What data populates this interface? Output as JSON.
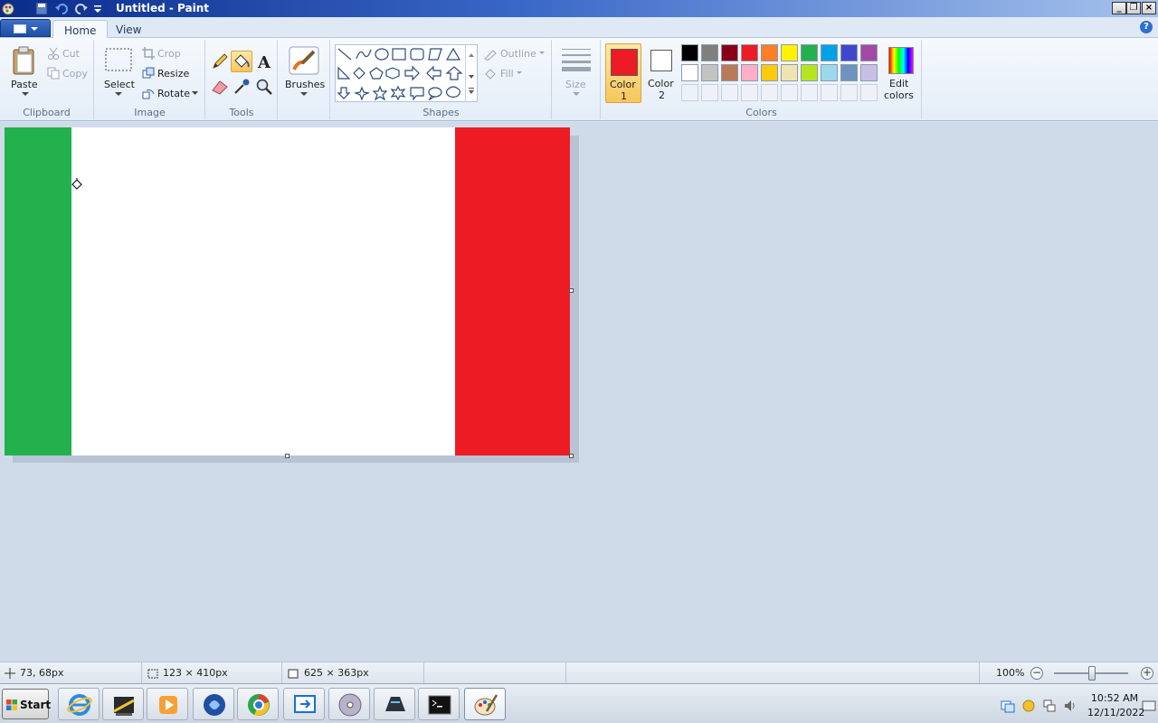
{
  "window": {
    "title": "Untitled - Paint"
  },
  "tabs": [
    {
      "label": "Home",
      "active": true
    },
    {
      "label": "View",
      "active": false
    }
  ],
  "ribbon": {
    "clipboard": {
      "group_label": "Clipboard",
      "paste": "Paste",
      "cut": "Cut",
      "copy": "Copy"
    },
    "image": {
      "group_label": "Image",
      "select": "Select",
      "crop": "Crop",
      "resize": "Resize",
      "rotate": "Rotate"
    },
    "tools": {
      "group_label": "Tools",
      "text_tool_glyph": "A"
    },
    "brushes": {
      "label": "Brushes"
    },
    "shapes": {
      "group_label": "Shapes",
      "outline": "Outline",
      "fill": "Fill"
    },
    "size": {
      "label": "Size"
    },
    "colors": {
      "group_label": "Colors",
      "color1_line1": "Color",
      "color1_line2": "1",
      "color2_line1": "Color",
      "color2_line2": "2",
      "edit_line1": "Edit",
      "edit_line2": "colors",
      "color1_value": "#ed1c24",
      "color2_value": "#ffffff",
      "palette_row1": [
        "#000000",
        "#7f7f7f",
        "#880015",
        "#ed1c24",
        "#ff7f27",
        "#fff200",
        "#22b14c",
        "#00a2e8",
        "#3f48cc",
        "#a349a4"
      ],
      "palette_row2": [
        "#ffffff",
        "#c3c3c3",
        "#b97a57",
        "#ffaec9",
        "#ffc90e",
        "#efe4b0",
        "#b5e61d",
        "#99d9ea",
        "#7092be",
        "#c8bfe7"
      ]
    }
  },
  "canvas": {
    "stripe_colors": [
      "#22b14c",
      "#ffffff",
      "#ed1c24"
    ]
  },
  "statusbar": {
    "cursor_pos": "73, 68px",
    "selection_size": "123 × 410px",
    "image_size": "625 × 363px",
    "zoom": "100%"
  },
  "taskbar": {
    "start": "Start",
    "items": [
      "internet-explorer",
      "file-manager",
      "media-player",
      "app-blue",
      "chrome",
      "remote-app",
      "dvd",
      "game-app",
      "cmd",
      "paint"
    ],
    "clock_time": "10:52 AM",
    "clock_date": "12/11/2022"
  }
}
